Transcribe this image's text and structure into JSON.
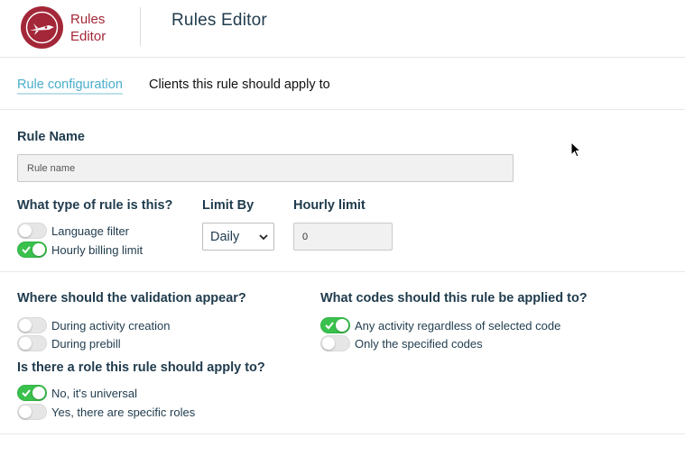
{
  "header": {
    "brand_line1": "Rules",
    "brand_line2": "Editor",
    "title": "Rules Editor",
    "logo_icon": "rocket-icon",
    "brand_color": "#a32738"
  },
  "tabs": [
    {
      "label": "Rule configuration",
      "active": true
    },
    {
      "label": "Clients this rule should apply to",
      "active": false
    }
  ],
  "rule_name": {
    "label": "Rule Name",
    "placeholder": "Rule name",
    "value": ""
  },
  "rule_type": {
    "label": "What type of rule is this?",
    "options": [
      {
        "label": "Language filter",
        "on": false
      },
      {
        "label": "Hourly billing limit",
        "on": true
      }
    ]
  },
  "limit_by": {
    "label": "Limit By",
    "selected": "Daily"
  },
  "hourly_limit": {
    "label": "Hourly limit",
    "value": "0"
  },
  "validation": {
    "label": "Where should the validation appear?",
    "options": [
      {
        "label": "During activity creation",
        "on": false
      },
      {
        "label": "During prebill",
        "on": false
      }
    ]
  },
  "codes": {
    "label": "What codes should this rule be applied to?",
    "options": [
      {
        "label": "Any activity regardless of selected code",
        "on": true
      },
      {
        "label": "Only the specified codes",
        "on": false
      }
    ]
  },
  "roles": {
    "label": "Is there a role this rule should apply to?",
    "options": [
      {
        "label": "No, it's universal",
        "on": true
      },
      {
        "label": "Yes, there are specific roles",
        "on": false
      }
    ]
  },
  "colors": {
    "accent": "#4aaecb",
    "toggle_on": "#3ac14d",
    "heading": "#1f3b4d"
  }
}
